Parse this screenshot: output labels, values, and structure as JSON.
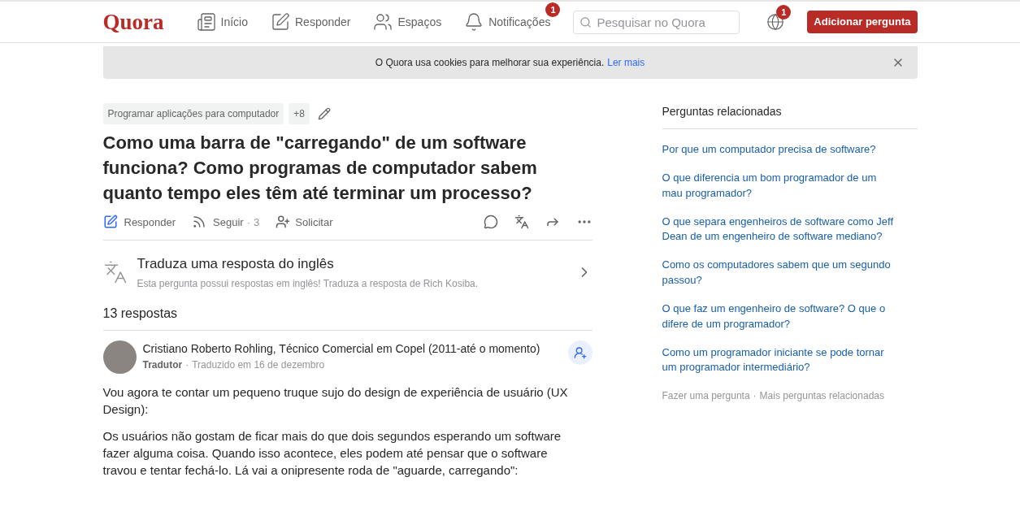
{
  "header": {
    "logo": "Quora",
    "nav": [
      {
        "kind": "home",
        "label": "Início"
      },
      {
        "kind": "answer",
        "label": "Responder"
      },
      {
        "kind": "spaces",
        "label": "Espaços"
      },
      {
        "kind": "notifications",
        "label": "Notificações",
        "badge": "1"
      }
    ],
    "search": {
      "placeholder": "Pesquisar no Quora"
    },
    "language_badge": "1",
    "add_question": "Adicionar pergunta"
  },
  "cookie_banner": {
    "text": "O Quora usa cookies para melhorar sua experiência.",
    "link": "Ler mais"
  },
  "question": {
    "topics": [
      "Programar aplicações para computador"
    ],
    "more_topics": "+8",
    "title": "Como uma barra de \"carregando\" de um software funciona? Como programas de computador sabem quanto tempo eles têm até terminar um processo?",
    "actions": {
      "answer": "Responder",
      "follow": "Seguir",
      "separator": "·",
      "follow_count": "3",
      "request": "Solicitar"
    }
  },
  "translate_prompt": {
    "title": "Traduza uma resposta do inglês",
    "subtitle": "Esta pergunta possui respostas em inglês! Traduza a resposta de Rich Kosiba."
  },
  "answers_count": "13 respostas",
  "answer": {
    "author": "Cristiano Roberto Rohling, Técnico Comercial em Copel (2011-até o momento)",
    "role": "Tradutor",
    "separator": "·",
    "date": "Traduzido em 16 de dezembro",
    "paragraphs": [
      "Vou agora te contar um pequeno truque sujo do design de experiência de usuário (UX Design):",
      "Os usuários não gostam de ficar mais do que dois segundos esperando um software fazer alguma coisa. Quando isso acontece, eles podem até pensar que o software travou e tentar fechá-lo. Lá vai a onipresente roda de \"aguarde, carregando\":"
    ]
  },
  "related": {
    "title": "Perguntas relacionadas",
    "items": [
      "Por que um computador precisa de software?",
      "O que diferencia um bom programador de um mau programador?",
      "O que separa engenheiros de software como Jeff Dean de um engenheiro de software mediano?",
      "Como os computadores sabem que um segundo passou?",
      "O que faz um engenheiro de software? O que o difere de um programador?",
      "Como um programador iniciante se pode tornar um programador intermediário?"
    ],
    "footer": {
      "ask": "Fazer uma pergunta",
      "separator": "·",
      "more": "Mais perguntas relacionadas"
    }
  }
}
